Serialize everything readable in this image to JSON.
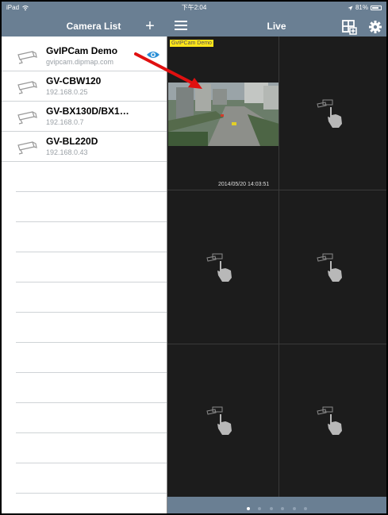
{
  "status_bar": {
    "left": "iPad",
    "time": "下午2:04",
    "battery": "81%"
  },
  "left_panel": {
    "title": "Camera List",
    "add_label": "+",
    "cameras": [
      {
        "name": "GvIPCam Demo",
        "address": "gvipcam.dipmap.com",
        "icon": "camera-icon",
        "viewing": true
      },
      {
        "name": "GV-CBW120",
        "address": "192.168.0.25",
        "icon": "camera-icon"
      },
      {
        "name": "GV-BX130D/BX1…",
        "address": "192.168.0.7",
        "icon": "camera-icon"
      },
      {
        "name": "GV-BL220D",
        "address": "192.168.0.43",
        "icon": "camera-icon"
      }
    ]
  },
  "right_panel": {
    "title": "Live",
    "menu_icon": "hamburger-menu-icon",
    "layout_icon": "grid-layout-icon",
    "settings_icon": "gear-icon",
    "live_cells": [
      {
        "camera_label": "GvIPCam Demo",
        "timestamp": "2014/05/20 14:03:51",
        "has_video": true
      },
      {
        "placeholder_icon": "tap-to-add-icon"
      },
      {
        "placeholder_icon": "tap-to-add-icon"
      },
      {
        "placeholder_icon": "tap-to-add-icon"
      },
      {
        "placeholder_icon": "tap-to-add-icon"
      },
      {
        "placeholder_icon": "tap-to-add-icon"
      }
    ]
  },
  "pager": {
    "pages": 6,
    "current": 1
  },
  "colors": {
    "bar": "#6a7f93",
    "live_bg": "#1c1c1c",
    "label_bg": "#ffe51a",
    "accent": "#2a8fd6",
    "arrow": "#e01010"
  }
}
